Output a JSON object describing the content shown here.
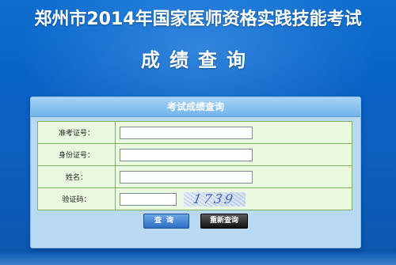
{
  "header": {
    "title": "郑州市2014年国家医师资格实践技能考试",
    "subtitle": "成绩查询"
  },
  "panel": {
    "title": "考试成绩查询",
    "fields": [
      {
        "label": "准考证号：",
        "value": ""
      },
      {
        "label": "身份证号：",
        "value": ""
      },
      {
        "label": "姓名：",
        "value": ""
      },
      {
        "label": "验证码：",
        "value": ""
      }
    ],
    "captcha_text": "1739",
    "query_button": "查询",
    "reset_button": "重新查询"
  },
  "colors": {
    "background": "#0b63c6",
    "panel": "#b9d9f2",
    "form": "#eaf8e0",
    "query_button": "#2e6fc4",
    "reset_button": "#111111"
  }
}
